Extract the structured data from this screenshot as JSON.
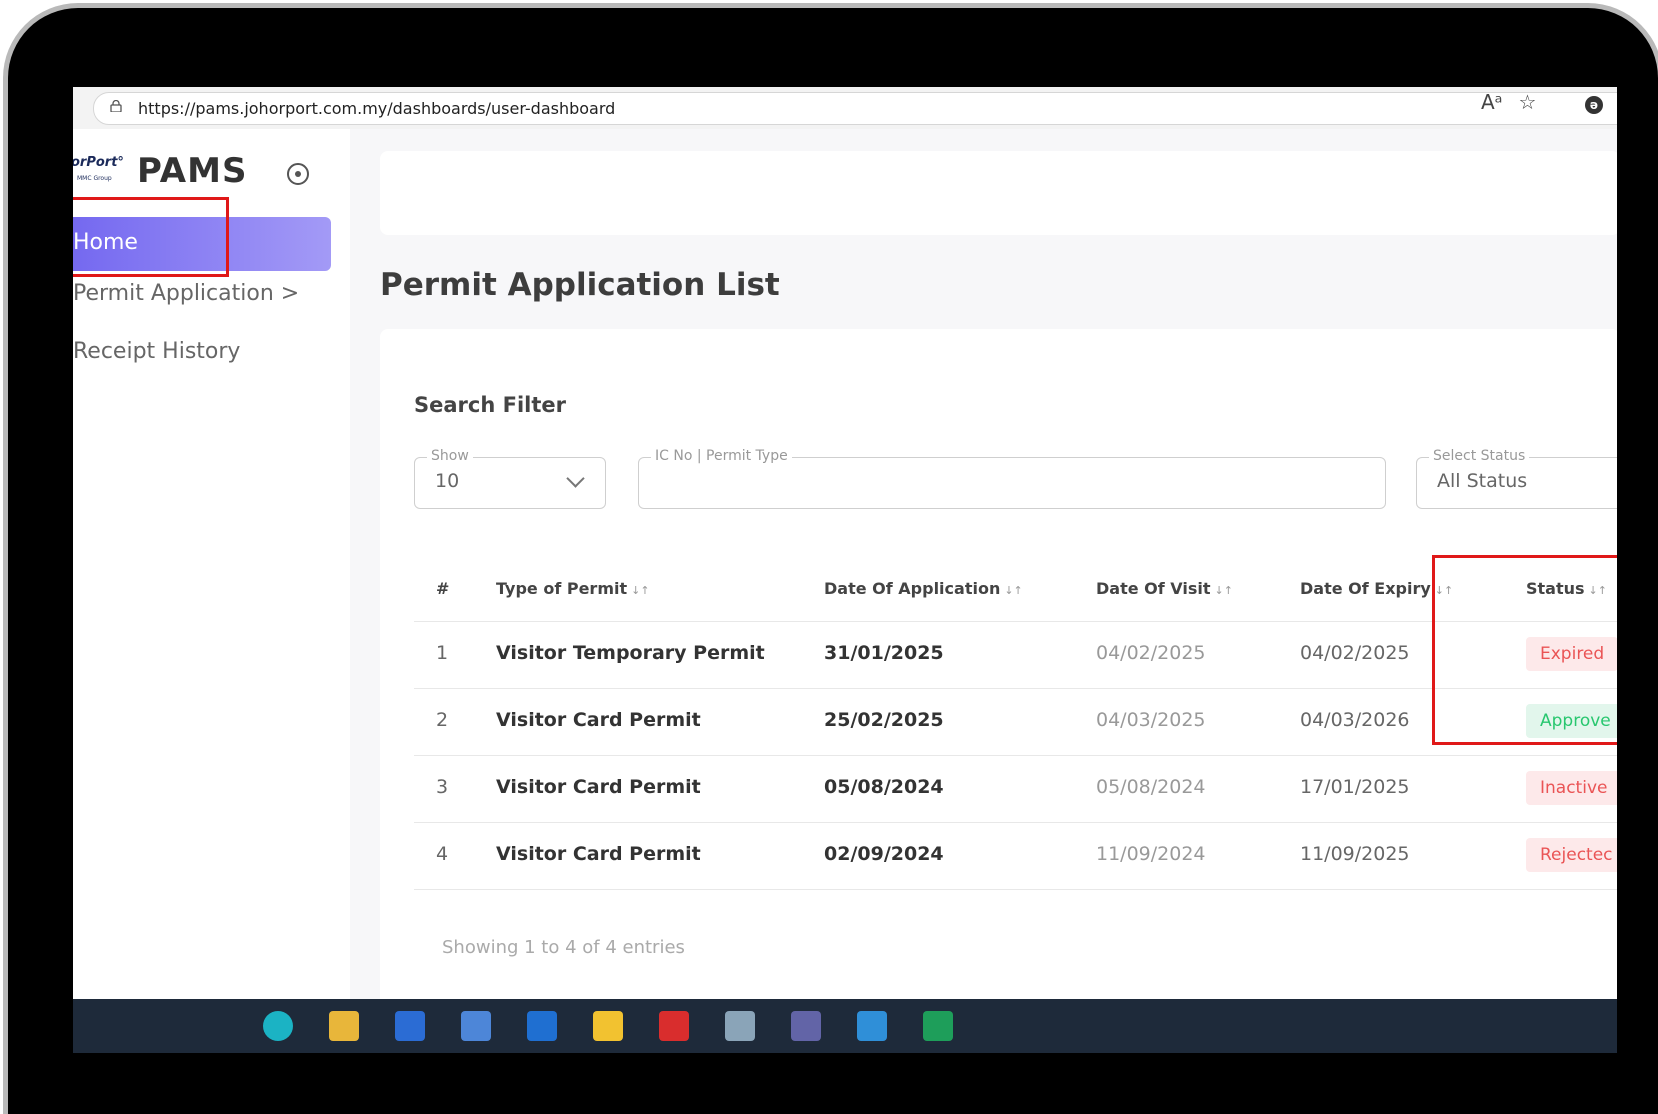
{
  "browser": {
    "url": "https://pams.johorport.com.my/dashboards/user-dashboard",
    "read_aloud_icon": "read-aloud-icon",
    "favorite_icon": "star-icon",
    "read_aloud_glyph": "Aᵃ",
    "favorite_glyph": "☆",
    "extension_glyph": "ə"
  },
  "sidebar": {
    "logo_text": "orPort°",
    "logo_sub": "MMC Group",
    "brand": "PAMS",
    "items": [
      {
        "label": "Home",
        "active": true
      },
      {
        "label": "Permit Application >"
      },
      {
        "label": "Receipt History"
      }
    ]
  },
  "main": {
    "title": "Permit Application List",
    "filter": {
      "title": "Search Filter",
      "show": {
        "label": "Show",
        "value": "10"
      },
      "search": {
        "label": "IC No | Permit Type",
        "value": ""
      },
      "status": {
        "label": "Select Status",
        "value": "All Status"
      }
    },
    "table": {
      "headers": [
        "#",
        "Type of Permit",
        "Date Of Application",
        "Date Of Visit",
        "Date Of Expiry",
        "Status"
      ],
      "sort_glyph": "↓↑",
      "rows": [
        {
          "num": "1",
          "type": "Visitor Temporary Permit",
          "applied": "31/01/2025",
          "visit": "04/02/2025",
          "expiry": "04/02/2025",
          "status": "Expired"
        },
        {
          "num": "2",
          "type": "Visitor Card Permit",
          "applied": "25/02/2025",
          "visit": "04/03/2025",
          "expiry": "04/03/2026",
          "status": "Approve"
        },
        {
          "num": "3",
          "type": "Visitor Card Permit",
          "applied": "05/08/2024",
          "visit": "05/08/2024",
          "expiry": "17/01/2025",
          "status": "Inactive"
        },
        {
          "num": "4",
          "type": "Visitor Card Permit",
          "applied": "02/09/2024",
          "visit": "11/09/2024",
          "expiry": "11/09/2025",
          "status": "Rejectec"
        }
      ],
      "footer": "Showing 1 to 4 of 4 entries"
    }
  },
  "colors": {
    "accent": "#7367f0",
    "danger": "#ea5455",
    "success": "#28c76f",
    "highlight": "#e01818"
  }
}
